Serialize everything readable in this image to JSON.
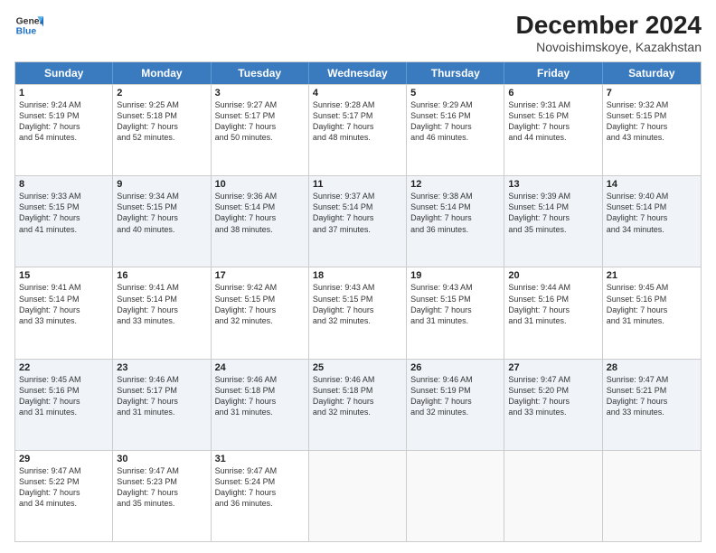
{
  "header": {
    "logo_line1": "General",
    "logo_line2": "Blue",
    "main_title": "December 2024",
    "sub_title": "Novoishimskoye, Kazakhstan"
  },
  "weekdays": [
    "Sunday",
    "Monday",
    "Tuesday",
    "Wednesday",
    "Thursday",
    "Friday",
    "Saturday"
  ],
  "weeks": [
    [
      {
        "day": 1,
        "sunrise": "9:24 AM",
        "sunset": "5:19 PM",
        "daylight": "7 hours and 54 minutes."
      },
      {
        "day": 2,
        "sunrise": "9:25 AM",
        "sunset": "5:18 PM",
        "daylight": "7 hours and 52 minutes."
      },
      {
        "day": 3,
        "sunrise": "9:27 AM",
        "sunset": "5:17 PM",
        "daylight": "7 hours and 50 minutes."
      },
      {
        "day": 4,
        "sunrise": "9:28 AM",
        "sunset": "5:17 PM",
        "daylight": "7 hours and 48 minutes."
      },
      {
        "day": 5,
        "sunrise": "9:29 AM",
        "sunset": "5:16 PM",
        "daylight": "7 hours and 46 minutes."
      },
      {
        "day": 6,
        "sunrise": "9:31 AM",
        "sunset": "5:16 PM",
        "daylight": "7 hours and 44 minutes."
      },
      {
        "day": 7,
        "sunrise": "9:32 AM",
        "sunset": "5:15 PM",
        "daylight": "7 hours and 43 minutes."
      }
    ],
    [
      {
        "day": 8,
        "sunrise": "9:33 AM",
        "sunset": "5:15 PM",
        "daylight": "7 hours and 41 minutes."
      },
      {
        "day": 9,
        "sunrise": "9:34 AM",
        "sunset": "5:15 PM",
        "daylight": "7 hours and 40 minutes."
      },
      {
        "day": 10,
        "sunrise": "9:36 AM",
        "sunset": "5:14 PM",
        "daylight": "7 hours and 38 minutes."
      },
      {
        "day": 11,
        "sunrise": "9:37 AM",
        "sunset": "5:14 PM",
        "daylight": "7 hours and 37 minutes."
      },
      {
        "day": 12,
        "sunrise": "9:38 AM",
        "sunset": "5:14 PM",
        "daylight": "7 hours and 36 minutes."
      },
      {
        "day": 13,
        "sunrise": "9:39 AM",
        "sunset": "5:14 PM",
        "daylight": "7 hours and 35 minutes."
      },
      {
        "day": 14,
        "sunrise": "9:40 AM",
        "sunset": "5:14 PM",
        "daylight": "7 hours and 34 minutes."
      }
    ],
    [
      {
        "day": 15,
        "sunrise": "9:41 AM",
        "sunset": "5:14 PM",
        "daylight": "7 hours and 33 minutes."
      },
      {
        "day": 16,
        "sunrise": "9:41 AM",
        "sunset": "5:14 PM",
        "daylight": "7 hours and 33 minutes."
      },
      {
        "day": 17,
        "sunrise": "9:42 AM",
        "sunset": "5:15 PM",
        "daylight": "7 hours and 32 minutes."
      },
      {
        "day": 18,
        "sunrise": "9:43 AM",
        "sunset": "5:15 PM",
        "daylight": "7 hours and 32 minutes."
      },
      {
        "day": 19,
        "sunrise": "9:43 AM",
        "sunset": "5:15 PM",
        "daylight": "7 hours and 31 minutes."
      },
      {
        "day": 20,
        "sunrise": "9:44 AM",
        "sunset": "5:16 PM",
        "daylight": "7 hours and 31 minutes."
      },
      {
        "day": 21,
        "sunrise": "9:45 AM",
        "sunset": "5:16 PM",
        "daylight": "7 hours and 31 minutes."
      }
    ],
    [
      {
        "day": 22,
        "sunrise": "9:45 AM",
        "sunset": "5:16 PM",
        "daylight": "7 hours and 31 minutes."
      },
      {
        "day": 23,
        "sunrise": "9:46 AM",
        "sunset": "5:17 PM",
        "daylight": "7 hours and 31 minutes."
      },
      {
        "day": 24,
        "sunrise": "9:46 AM",
        "sunset": "5:18 PM",
        "daylight": "7 hours and 31 minutes."
      },
      {
        "day": 25,
        "sunrise": "9:46 AM",
        "sunset": "5:18 PM",
        "daylight": "7 hours and 32 minutes."
      },
      {
        "day": 26,
        "sunrise": "9:46 AM",
        "sunset": "5:19 PM",
        "daylight": "7 hours and 32 minutes."
      },
      {
        "day": 27,
        "sunrise": "9:47 AM",
        "sunset": "5:20 PM",
        "daylight": "7 hours and 33 minutes."
      },
      {
        "day": 28,
        "sunrise": "9:47 AM",
        "sunset": "5:21 PM",
        "daylight": "7 hours and 33 minutes."
      }
    ],
    [
      {
        "day": 29,
        "sunrise": "9:47 AM",
        "sunset": "5:22 PM",
        "daylight": "7 hours and 34 minutes."
      },
      {
        "day": 30,
        "sunrise": "9:47 AM",
        "sunset": "5:23 PM",
        "daylight": "7 hours and 35 minutes."
      },
      {
        "day": 31,
        "sunrise": "9:47 AM",
        "sunset": "5:24 PM",
        "daylight": "7 hours and 36 minutes."
      },
      null,
      null,
      null,
      null
    ]
  ],
  "labels": {
    "sunrise": "Sunrise:",
    "sunset": "Sunset:",
    "daylight": "Daylight:"
  }
}
